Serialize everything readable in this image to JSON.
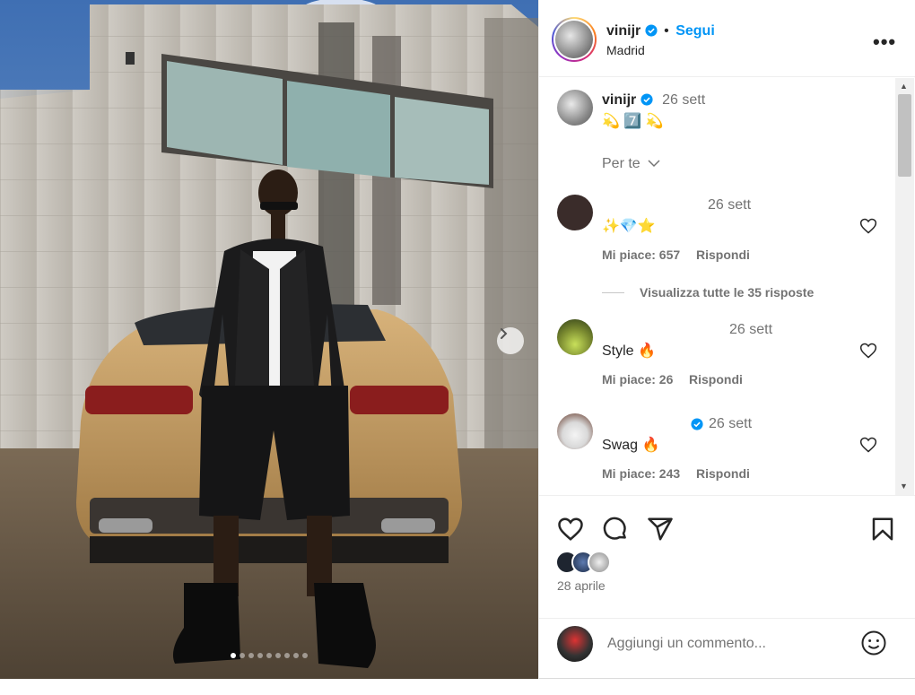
{
  "header": {
    "username": "vinijr",
    "separator": "•",
    "follow_label": "Segui",
    "location": "Madrid",
    "more_label": "•••"
  },
  "caption": {
    "username": "vinijr",
    "time": "26 sett",
    "text": "💫 7️⃣ 💫",
    "per_te_label": "Per te"
  },
  "comments": [
    {
      "time": "26 sett",
      "text": "✨💎⭐",
      "likes_label": "Mi piace: 657",
      "reply_label": "Rispondi",
      "view_replies": "Visualizza tutte le 35 risposte"
    },
    {
      "time": "26 sett",
      "text": "Style 🔥",
      "likes_label": "Mi piace: 26",
      "reply_label": "Rispondi"
    },
    {
      "time": "26 sett",
      "text": "Swag 🔥",
      "likes_label": "Mi piace: 243",
      "reply_label": "Rispondi"
    }
  ],
  "post": {
    "date": "28 aprile",
    "carousel_total": 9,
    "carousel_active": 1
  },
  "add_comment": {
    "placeholder": "Aggiungi un commento..."
  },
  "icons": [
    "like-icon",
    "comment-icon",
    "share-icon",
    "save-icon",
    "emoji-icon",
    "verified-icon",
    "chevron-right-icon",
    "chevron-down-icon",
    "more-icon"
  ],
  "colors": {
    "accent": "#0095f6",
    "text": "#262626",
    "secondary": "#737373"
  }
}
